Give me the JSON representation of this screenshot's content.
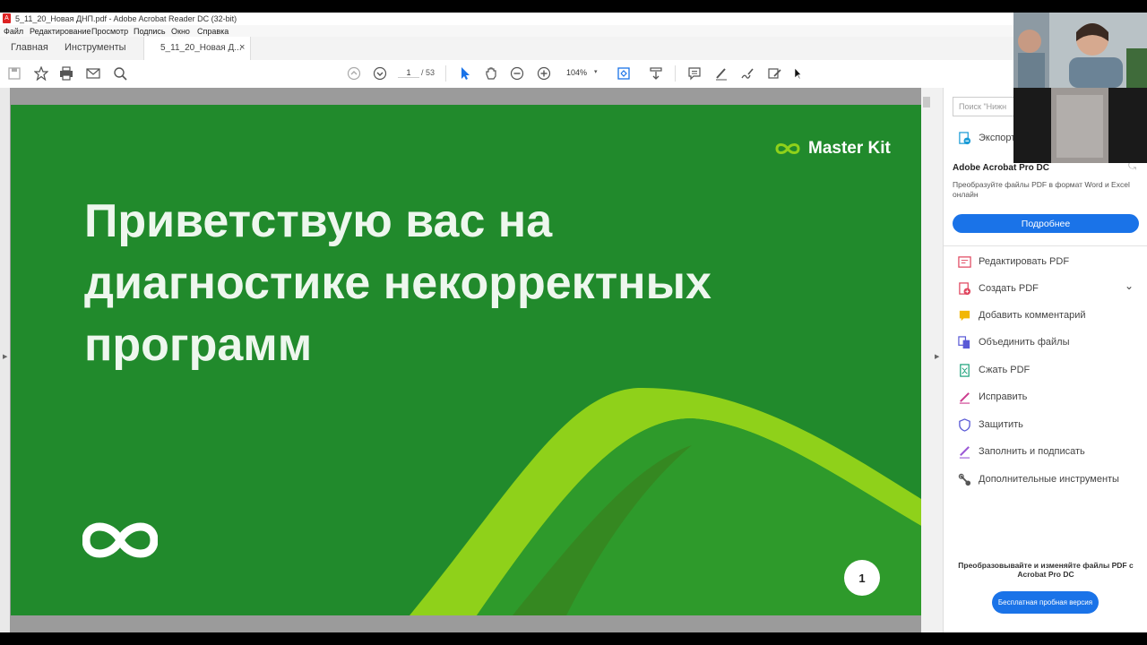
{
  "window": {
    "title": "5_11_20_Новая ДНП.pdf - Adobe Acrobat Reader DC (32-bit)"
  },
  "menu": [
    "Файл",
    "Редактирование",
    "Просмотр",
    "Подпись",
    "Окно",
    "Справка"
  ],
  "tabs": {
    "home": "Главная",
    "tools": "Инструменты",
    "document": "5_11_20_Новая Д...",
    "close": "×"
  },
  "toolbar": {
    "page_current": "1",
    "page_total": "/ 53",
    "zoom": "104%"
  },
  "slide": {
    "title_lines": [
      "Приветствую вас на",
      "диагностике некорректных",
      "программ"
    ],
    "brand": "Master Kit",
    "page_number": "1",
    "colors": {
      "background": "#218a2c",
      "ribbon_light": "#8fd11a",
      "ribbon_dark": "#3f8f1c"
    }
  },
  "right_pane": {
    "search_placeholder": "Поиск \"Нижн",
    "export_label": "Экспорт",
    "promo_title": "Adobe Acrobat Pro DC",
    "promo_desc": "Преобразуйте файлы PDF в формат Word и Excel онлайн",
    "promo_button": "Подробнее",
    "tools": [
      {
        "label": "Редактировать PDF",
        "icon": "edit-pdf-icon",
        "color": "#e0455e"
      },
      {
        "label": "Создать PDF",
        "icon": "create-pdf-icon",
        "color": "#e0455e"
      },
      {
        "label": "Добавить комментарий",
        "icon": "comment-icon",
        "color": "#f2b705"
      },
      {
        "label": "Объединить файлы",
        "icon": "combine-files-icon",
        "color": "#5a5ad6"
      },
      {
        "label": "Сжать PDF",
        "icon": "compress-pdf-icon",
        "color": "#1aa17a"
      },
      {
        "label": "Исправить",
        "icon": "fix-pen-icon",
        "color": "#cc3d8f"
      },
      {
        "label": "Защитить",
        "icon": "shield-icon",
        "color": "#5a5ad6"
      },
      {
        "label": "Заполнить и подписать",
        "icon": "fill-sign-icon",
        "color": "#9b59d6"
      },
      {
        "label": "Дополнительные инструменты",
        "icon": "more-tools-icon",
        "color": "#555555"
      }
    ],
    "bottom_promo": "Преобразовывайте и изменяйте файлы PDF с Acrobat Pro DC",
    "trial_button": "Бесплатная пробная версия"
  }
}
